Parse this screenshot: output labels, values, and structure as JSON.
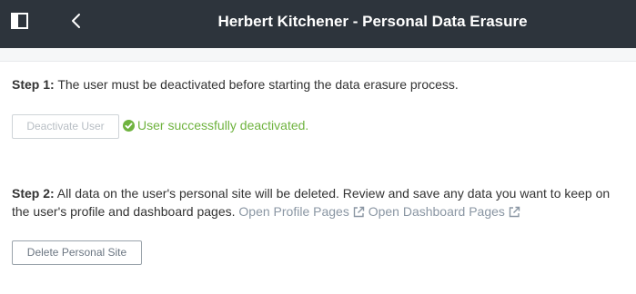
{
  "header": {
    "title": "Herbert Kitchener - Personal Data Erasure",
    "left_icon": "sidebar-toggle-icon",
    "back_icon": "chevron-left-icon",
    "background": "#2d343c"
  },
  "step1": {
    "label": "Step 1:",
    "text": " The user must be deactivated before starting the data erasure process.",
    "button_label": "Deactivate User",
    "button_disabled": true,
    "status_icon": "check-circle-icon",
    "status_text": "User successfully deactivated.",
    "status_color": "#6fb33f"
  },
  "step2": {
    "label": "Step 2:",
    "text": " All data on the user's personal site will be deleted. Review and save any data you want to keep on the user's profile and dashboard pages. ",
    "link_profile": "Open Profile Pages",
    "link_dashboard": "Open Dashboard Pages",
    "link_icon": "external-link-icon",
    "button_label": "Delete Personal Site"
  }
}
